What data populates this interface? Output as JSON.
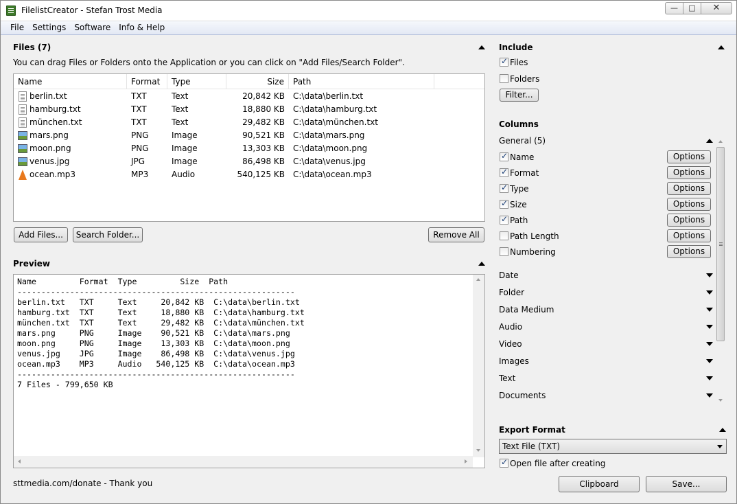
{
  "window": {
    "title": "FilelistCreator - Stefan Trost Media"
  },
  "menu": [
    "File",
    "Settings",
    "Software",
    "Info & Help"
  ],
  "files": {
    "title": "Files (7)",
    "hint": "You can drag Files or Folders onto the Application or you can click on \"Add Files/Search Folder\".",
    "columns": [
      "Name",
      "Format",
      "Type",
      "Size",
      "Path"
    ],
    "rows": [
      {
        "name": "berlin.txt",
        "format": "TXT",
        "type": "Text",
        "size": "20,842 KB",
        "path": "C:\\data\\berlin.txt",
        "icon": "text-file-icon"
      },
      {
        "name": "hamburg.txt",
        "format": "TXT",
        "type": "Text",
        "size": "18,880 KB",
        "path": "C:\\data\\hamburg.txt",
        "icon": "text-file-icon"
      },
      {
        "name": "münchen.txt",
        "format": "TXT",
        "type": "Text",
        "size": "29,482 KB",
        "path": "C:\\data\\münchen.txt",
        "icon": "text-file-icon"
      },
      {
        "name": "mars.png",
        "format": "PNG",
        "type": "Image",
        "size": "90,521 KB",
        "path": "C:\\data\\mars.png",
        "icon": "image-file-icon"
      },
      {
        "name": "moon.png",
        "format": "PNG",
        "type": "Image",
        "size": "13,303 KB",
        "path": "C:\\data\\moon.png",
        "icon": "image-file-icon"
      },
      {
        "name": "venus.jpg",
        "format": "JPG",
        "type": "Image",
        "size": "86,498 KB",
        "path": "C:\\data\\venus.jpg",
        "icon": "image-file-icon"
      },
      {
        "name": "ocean.mp3",
        "format": "MP3",
        "type": "Audio",
        "size": "540,125 KB",
        "path": "C:\\data\\ocean.mp3",
        "icon": "audio-file-icon"
      }
    ],
    "buttons": {
      "add_files": "Add Files...",
      "search_folder": "Search Folder...",
      "remove_all": "Remove All"
    }
  },
  "preview": {
    "title": "Preview",
    "text": "Name         Format  Type         Size  Path\n----------------------------------------------------------\nberlin.txt   TXT     Text     20,842 KB  C:\\data\\berlin.txt\nhamburg.txt  TXT     Text     18,880 KB  C:\\data\\hamburg.txt\nmünchen.txt  TXT     Text     29,482 KB  C:\\data\\münchen.txt\nmars.png     PNG     Image    90,521 KB  C:\\data\\mars.png\nmoon.png     PNG     Image    13,303 KB  C:\\data\\moon.png\nvenus.jpg    JPG     Image    86,498 KB  C:\\data\\venus.jpg\nocean.mp3    MP3     Audio   540,125 KB  C:\\data\\ocean.mp3\n----------------------------------------------------------\n7 Files - 799,650 KB"
  },
  "footer": {
    "donate": "sttmedia.com/donate - Thank you"
  },
  "include": {
    "title": "Include",
    "files": {
      "label": "Files",
      "checked": true
    },
    "folders": {
      "label": "Folders",
      "checked": false
    },
    "filter_button": "Filter..."
  },
  "columns_panel": {
    "title": "Columns",
    "general_title": "General (5)",
    "options_label": "Options",
    "general_items": [
      {
        "label": "Name",
        "checked": true
      },
      {
        "label": "Format",
        "checked": true
      },
      {
        "label": "Type",
        "checked": true
      },
      {
        "label": "Size",
        "checked": true
      },
      {
        "label": "Path",
        "checked": true
      },
      {
        "label": "Path Length",
        "checked": false
      },
      {
        "label": "Numbering",
        "checked": false
      }
    ],
    "groups": [
      "Date",
      "Folder",
      "Data Medium",
      "Audio",
      "Video",
      "Images",
      "Text",
      "Documents"
    ]
  },
  "export": {
    "title": "Export Format",
    "selected": "Text File (TXT)",
    "open_after": {
      "label": "Open file after creating",
      "checked": true
    },
    "clipboard": "Clipboard",
    "save": "Save..."
  }
}
